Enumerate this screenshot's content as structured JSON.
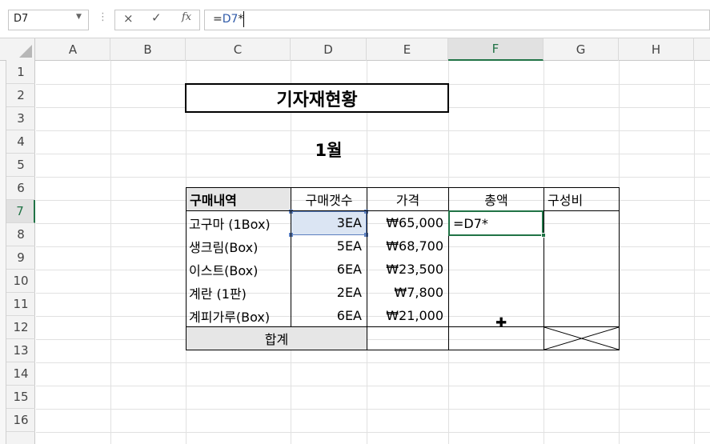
{
  "formula_bar": {
    "name_box": "D7",
    "dots": "⋮",
    "cancel_icon": "×",
    "enter_icon": "✓",
    "fx_label": "fx",
    "formula_prefix": "=",
    "formula_ref": "D7",
    "formula_suffix": "*"
  },
  "columns": [
    "A",
    "B",
    "C",
    "D",
    "E",
    "F",
    "G",
    "H"
  ],
  "rows": [
    "1",
    "2",
    "3",
    "4",
    "5",
    "6",
    "7",
    "8",
    "9",
    "10",
    "11",
    "12",
    "13",
    "14",
    "15",
    "16"
  ],
  "sheet": {
    "title": "기자재현황",
    "month": "1월",
    "table_headers": {
      "item": "구매내역",
      "count": "구매갯수",
      "price": "가격",
      "total": "총액",
      "ratio": "구성비"
    },
    "items": [
      {
        "name": "고구마 (1Box)",
        "count": "3EA",
        "price": "₩65,000"
      },
      {
        "name": "생크림(Box)",
        "count": "5EA",
        "price": "₩68,700"
      },
      {
        "name": "이스트(Box)",
        "count": "6EA",
        "price": "₩23,500"
      },
      {
        "name": "계란 (1판)",
        "count": "2EA",
        "price": "₩7,800"
      },
      {
        "name": "계피가루(Box)",
        "count": "6EA",
        "price": "₩21,000"
      }
    ],
    "sum_label": "합계",
    "editing_cell_text": "=D7*"
  },
  "cursor_icon": "✚",
  "colors": {
    "excel_green": "#217346",
    "selection_blue": "#5b7fbf",
    "reference_text": "#2f5aa8"
  }
}
